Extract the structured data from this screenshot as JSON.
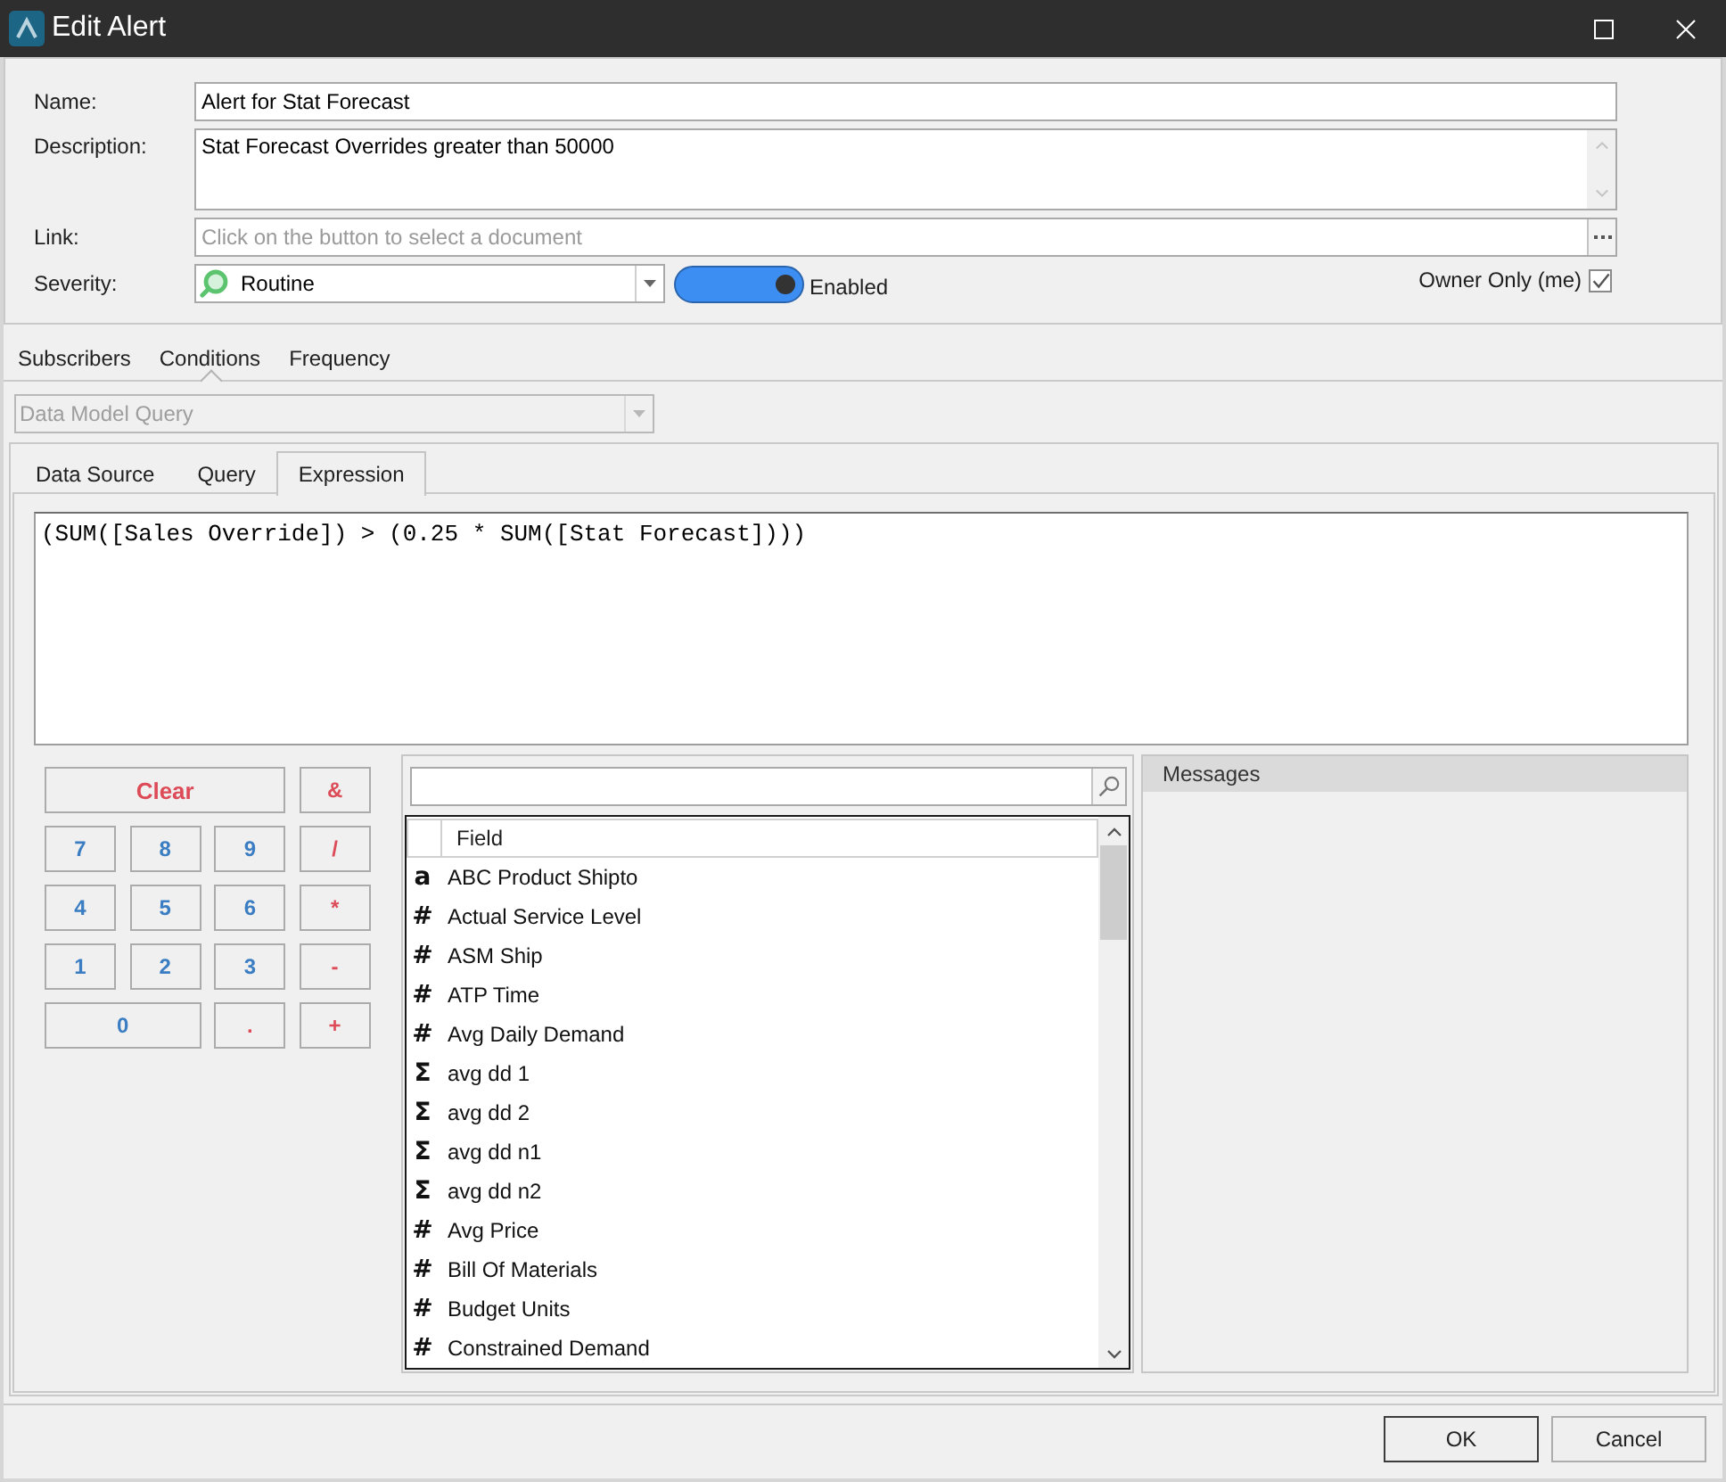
{
  "window": {
    "title": "Edit Alert"
  },
  "form": {
    "name": {
      "label": "Name:",
      "value": "Alert for Stat Forecast"
    },
    "description": {
      "label": "Description:",
      "value": "Stat Forecast Overrides greater than 50000"
    },
    "link": {
      "label": "Link:",
      "placeholder": "Click on the button to select a document"
    },
    "severity": {
      "label": "Severity:",
      "value": "Routine"
    },
    "enabled_toggle": {
      "label": "Enabled",
      "on": true
    },
    "owner_only": {
      "label": "Owner Only (me)",
      "checked": true
    }
  },
  "tabs": [
    {
      "label": "Subscribers",
      "selected": false
    },
    {
      "label": "Conditions",
      "selected": true
    },
    {
      "label": "Frequency",
      "selected": false
    }
  ],
  "query_type": {
    "value": "Data Model Query",
    "disabled": true
  },
  "expression_tabs": [
    {
      "label": "Data Source",
      "selected": false
    },
    {
      "label": "Query",
      "selected": false
    },
    {
      "label": "Expression",
      "selected": true
    }
  ],
  "expression": "(SUM([Sales Override]) > (0.25 * SUM([Stat Forecast])))",
  "keypad": [
    {
      "label": "Clear",
      "kind": "clear"
    },
    {
      "label": "&",
      "kind": "operator"
    },
    {
      "label": "7",
      "kind": "digit"
    },
    {
      "label": "8",
      "kind": "digit"
    },
    {
      "label": "9",
      "kind": "digit"
    },
    {
      "label": "/",
      "kind": "operator"
    },
    {
      "label": "4",
      "kind": "digit"
    },
    {
      "label": "5",
      "kind": "digit"
    },
    {
      "label": "6",
      "kind": "digit"
    },
    {
      "label": "*",
      "kind": "operator"
    },
    {
      "label": "1",
      "kind": "digit"
    },
    {
      "label": "2",
      "kind": "digit"
    },
    {
      "label": "3",
      "kind": "digit"
    },
    {
      "label": "-",
      "kind": "operator"
    },
    {
      "label": "0",
      "kind": "wide_digit"
    },
    {
      "label": ".",
      "kind": "operator"
    },
    {
      "label": "+",
      "kind": "operator"
    }
  ],
  "field_list": {
    "header": "Field",
    "rows": [
      {
        "icon": "a",
        "name": "ABC Product Shipto"
      },
      {
        "icon": "#",
        "name": "Actual Service Level"
      },
      {
        "icon": "#",
        "name": "ASM Ship"
      },
      {
        "icon": "#",
        "name": "ATP Time"
      },
      {
        "icon": "#",
        "name": "Avg Daily Demand"
      },
      {
        "icon": "Σ",
        "name": "avg dd 1"
      },
      {
        "icon": "Σ",
        "name": "avg dd 2"
      },
      {
        "icon": "Σ",
        "name": "avg dd n1"
      },
      {
        "icon": "Σ",
        "name": "avg dd n2"
      },
      {
        "icon": "#",
        "name": "Avg Price"
      },
      {
        "icon": "#",
        "name": "Bill Of Materials"
      },
      {
        "icon": "#",
        "name": "Budget Units"
      },
      {
        "icon": "#",
        "name": "Constrained Demand"
      }
    ]
  },
  "messages": {
    "title": "Messages"
  },
  "buttons": [
    {
      "label": "OK",
      "default": true
    },
    {
      "label": "Cancel",
      "default": false
    }
  ]
}
